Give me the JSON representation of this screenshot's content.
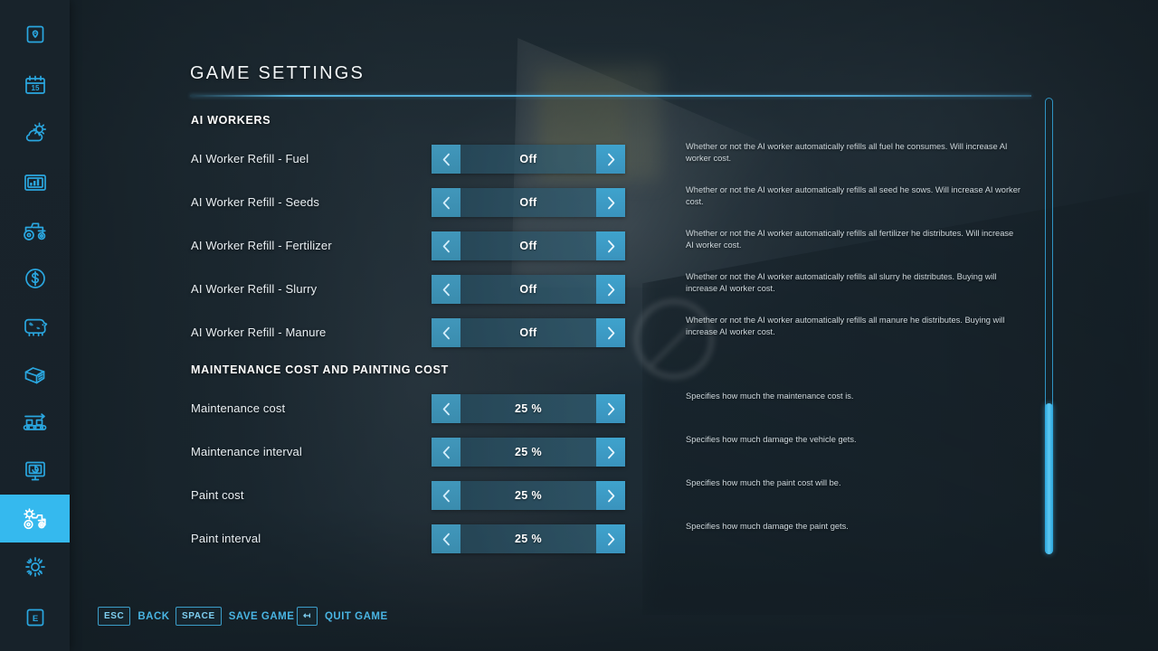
{
  "page": {
    "title": "GAME SETTINGS"
  },
  "sidebar": {
    "active_index": 10,
    "items": [
      {
        "label": "Quests",
        "icon": "quest-marker-icon"
      },
      {
        "label": "Calendar",
        "icon": "calendar-15-icon"
      },
      {
        "label": "Weather",
        "icon": "weather-sun-cloud-icon"
      },
      {
        "label": "Statistics",
        "icon": "bar-chart-icon"
      },
      {
        "label": "Vehicles",
        "icon": "tractor-icon"
      },
      {
        "label": "Finances",
        "icon": "dollar-coin-icon"
      },
      {
        "label": "Animals",
        "icon": "cow-icon"
      },
      {
        "label": "Contracts",
        "icon": "documents-icon"
      },
      {
        "label": "Production",
        "icon": "conveyor-belt-icon"
      },
      {
        "label": "Presentation",
        "icon": "presentation-board-icon"
      },
      {
        "label": "Game Settings",
        "icon": "gear-tractor-icon"
      },
      {
        "label": "Settings",
        "icon": "gear-icon"
      },
      {
        "label": "Help",
        "icon": "key-e-icon"
      }
    ]
  },
  "sections": [
    {
      "heading": "AI WORKERS",
      "rows": [
        {
          "label": "AI Worker Refill - Fuel",
          "value": "Off",
          "description": "Whether or not the AI worker automatically refills all fuel he consumes. Will increase AI worker cost."
        },
        {
          "label": "AI Worker Refill - Seeds",
          "value": "Off",
          "description": "Whether or not the AI worker automatically refills all seed he sows. Will increase AI worker cost."
        },
        {
          "label": "AI Worker Refill - Fertilizer",
          "value": "Off",
          "description": "Whether or not the AI worker automatically refills all fertilizer he distributes. Will increase AI worker cost."
        },
        {
          "label": "AI Worker Refill - Slurry",
          "value": "Off",
          "description": "Whether or not the AI worker automatically refills all slurry he distributes. Buying will increase AI worker cost."
        },
        {
          "label": "AI Worker Refill - Manure",
          "value": "Off",
          "description": "Whether or not the AI worker automatically refills all manure he distributes. Buying will increase AI worker cost."
        }
      ]
    },
    {
      "heading": "MAINTENANCE COST AND PAINTING COST",
      "rows": [
        {
          "label": "Maintenance cost",
          "value": "25 %",
          "description": "Specifies how much the maintenance cost is."
        },
        {
          "label": "Maintenance interval",
          "value": "25 %",
          "description": "Specifies how much damage the vehicle gets."
        },
        {
          "label": "Paint cost",
          "value": "25 %",
          "description": "Specifies how much the paint cost will be."
        },
        {
          "label": "Paint interval",
          "value": "25 %",
          "description": "Specifies how much damage the paint gets."
        }
      ]
    }
  ],
  "selector": {
    "prev_icon": "chevron-left-icon",
    "next_icon": "chevron-right-icon"
  },
  "bottom_bar": {
    "hints": [
      {
        "key": "ESC",
        "label": "BACK"
      },
      {
        "key": "SPACE",
        "label": "SAVE GAME"
      },
      {
        "key": "↤",
        "label": "QUIT GAME"
      }
    ]
  },
  "colors": {
    "accent": "#35b9ee",
    "accent_text": "#49b4e2",
    "panel_bg": "#22323b",
    "sidebar_bg": "#18232b"
  }
}
